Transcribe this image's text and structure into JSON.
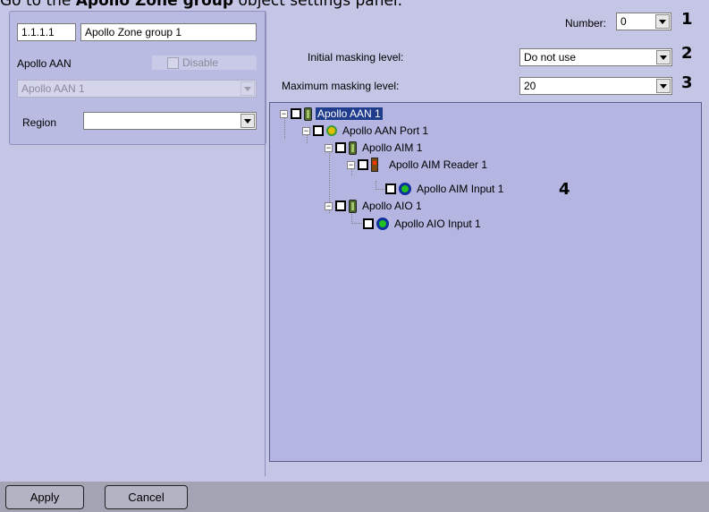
{
  "caption": {
    "prefix": "Go to the ",
    "bold": "Apollo Zone group",
    "suffix": " object settings panel."
  },
  "object": {
    "id": "1.1.1.1",
    "name": "Apollo Zone group 1"
  },
  "aan": {
    "label": "Apollo AAN",
    "disable_label": "Disable",
    "value": "Apollo AAN 1"
  },
  "region": {
    "label": "Region",
    "value": ""
  },
  "number": {
    "label": "Number:",
    "value": "0"
  },
  "initial_masking": {
    "label": "Initial masking level:",
    "value": "Do not use"
  },
  "maximum_masking": {
    "label": "Maximum masking level:",
    "value": "20"
  },
  "callouts": [
    "1",
    "2",
    "3",
    "4"
  ],
  "tree": [
    {
      "label": "Apollo AAN 1",
      "icon": "controller-icon",
      "selected": true
    },
    {
      "label": "Apollo AAN Port 1",
      "icon": "port-icon"
    },
    {
      "label": "Apollo AIM 1",
      "icon": "controller-icon"
    },
    {
      "label": "Apollo AIM Reader 1",
      "icon": "reader-icon"
    },
    {
      "label": "Apollo AIM Input 1",
      "icon": "input-icon"
    },
    {
      "label": "Apollo AIO 1",
      "icon": "controller-icon"
    },
    {
      "label": "Apollo AIO Input 1",
      "icon": "input-icon"
    }
  ],
  "buttons": {
    "apply": "Apply",
    "cancel": "Cancel"
  }
}
